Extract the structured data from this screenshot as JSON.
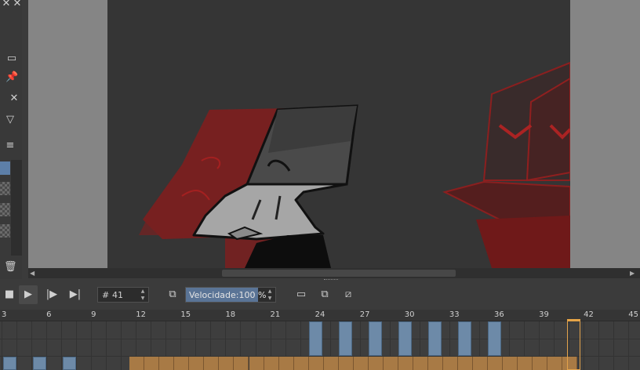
{
  "timeline": {
    "frame_label": "#",
    "current_frame": "41",
    "speed_label": "Velocidade:",
    "speed_value": "100 %",
    "speed_fraction": 1.0,
    "ruler_ticks": [
      "3",
      "6",
      "9",
      "12",
      "15",
      "18",
      "21",
      "24",
      "27",
      "30",
      "33",
      "36",
      "39",
      "42",
      "45"
    ]
  },
  "icons": {
    "dock": [
      "close-icon",
      "monitor-icon",
      "pin-icon",
      "close-icon",
      "filter-icon",
      "menu-icon",
      "trash-icon"
    ],
    "transport": [
      "stop-icon",
      "play-icon",
      "next-frame-icon",
      "last-frame-icon"
    ],
    "view": [
      "loop-icon",
      "onion-skin-icon",
      "frame-box-icon",
      "clip-icon",
      "no-crop-icon"
    ]
  },
  "colors": {
    "keyframe": "#6d8aa8",
    "onion": "#a87a45",
    "playhead": "#e2a24b"
  }
}
